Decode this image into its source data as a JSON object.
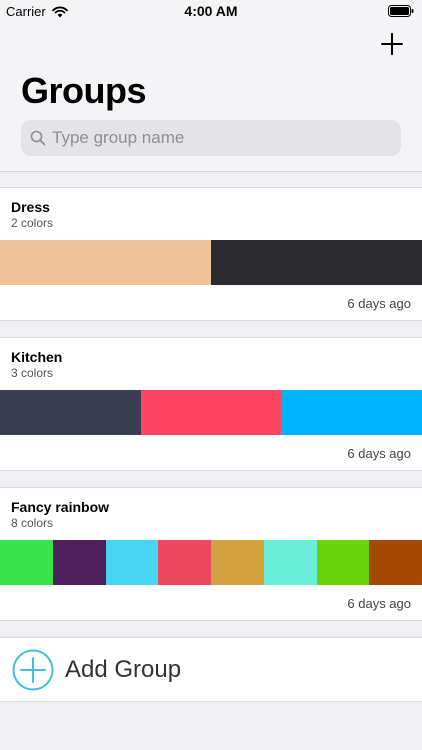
{
  "status_bar": {
    "carrier": "Carrier",
    "time": "4:00 AM",
    "wifi_icon": "wifi-icon",
    "battery_icon": "battery-icon"
  },
  "header": {
    "add_icon": "plus-icon",
    "title": "Groups",
    "search": {
      "icon": "search-icon",
      "placeholder": "Type group name",
      "value": ""
    }
  },
  "groups": [
    {
      "name": "Dress",
      "count": "2 colors",
      "date": "6 days ago",
      "colors": [
        "#efc39a",
        "#2b2b2f"
      ]
    },
    {
      "name": "Kitchen",
      "count": "3 colors",
      "date": "6 days ago",
      "colors": [
        "#3a3c52",
        "#fb4563",
        "#00b3f8"
      ]
    },
    {
      "name": "Fancy rainbow",
      "count": "8 colors",
      "date": "6 days ago",
      "colors": [
        "#37e348",
        "#4f1f5a",
        "#48d5f2",
        "#ec4760",
        "#d4a140",
        "#6aeed7",
        "#6bd20b",
        "#a44a06"
      ]
    }
  ],
  "add_group": {
    "icon": "plus-circle-icon",
    "label": "Add Group",
    "accent": "#3fc2d9"
  }
}
